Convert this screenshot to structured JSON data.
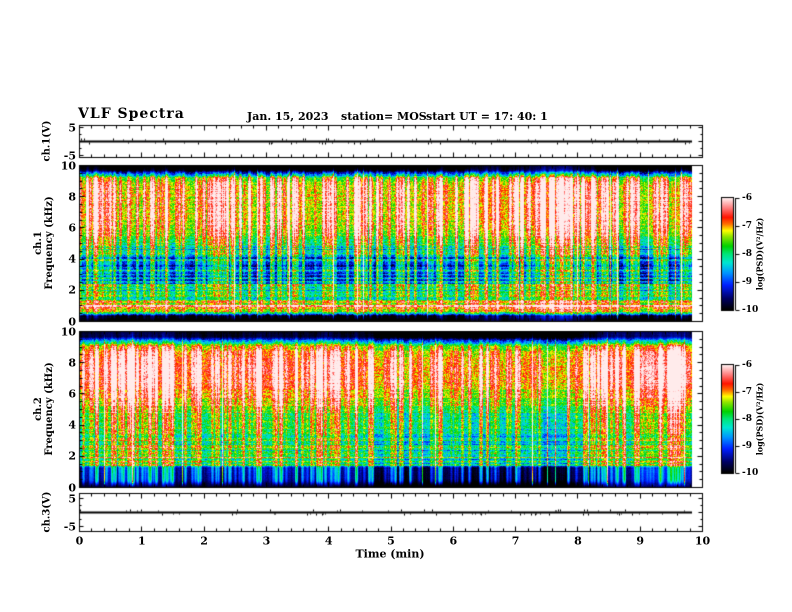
{
  "header": {
    "title": "VLF Spectra",
    "date": "Jan. 15, 2023",
    "station": "station= MOS",
    "start_ut": "start UT =  17: 40: 1"
  },
  "colors": {
    "background": "#ffffff",
    "frame": "#000000",
    "colormap": [
      [
        0.0,
        "#000000"
      ],
      [
        0.1,
        "#000064"
      ],
      [
        0.22,
        "#001eff"
      ],
      [
        0.33,
        "#0096ff"
      ],
      [
        0.42,
        "#00e6d2"
      ],
      [
        0.5,
        "#00e678"
      ],
      [
        0.57,
        "#00d200"
      ],
      [
        0.66,
        "#96e600"
      ],
      [
        0.71,
        "#ffff00"
      ],
      [
        0.77,
        "#ff6e00"
      ],
      [
        0.83,
        "#ff1400"
      ],
      [
        0.91,
        "#ff7878"
      ],
      [
        1.0,
        "#ffebeb"
      ]
    ]
  },
  "axes": {
    "time": {
      "label": "Time (min)",
      "min": 0,
      "max": 10,
      "ticks": [
        0,
        1,
        2,
        3,
        4,
        5,
        6,
        7,
        8,
        9,
        10
      ],
      "minor_step": 0.2
    },
    "ch1v": {
      "label": "ch.1(V)",
      "ticks": [
        5,
        -5
      ],
      "range": [
        -5,
        5
      ]
    },
    "spec1": {
      "label_line1": "ch.1",
      "label_line2": "Frequency (kHz)",
      "ticks": [
        10,
        8,
        6,
        4,
        2,
        0
      ],
      "range": [
        0,
        10
      ]
    },
    "spec2": {
      "label_line1": "ch.2",
      "label_line2": "Frequency (kHz)",
      "ticks": [
        10,
        8,
        6,
        4,
        2,
        0
      ],
      "range": [
        0,
        10
      ]
    },
    "ch3v": {
      "label": "ch.3(V)",
      "ticks": [
        5,
        -5
      ],
      "range": [
        -5,
        5
      ]
    }
  },
  "colorbars": [
    {
      "label": "log(PSD)(V²/Hz)",
      "ticks": [
        -6,
        -7,
        -8,
        -9,
        -10
      ],
      "min": -10,
      "max": -6
    },
    {
      "label": "log(PSD)(V²/Hz)",
      "ticks": [
        -6,
        -7,
        -8,
        -9,
        -10
      ],
      "min": -10,
      "max": -6
    }
  ],
  "chart_data": [
    {
      "type": "line",
      "panel": "ch1-voltage",
      "ylabel": "ch.1(V)",
      "ylim": [
        -5,
        5
      ],
      "xlim": [
        0,
        10
      ],
      "x_extent_min": [
        0,
        9.83
      ],
      "baseline_v": 0,
      "description": "flat trace at 0 V with sparse impulsive spikes under 1 V",
      "render": {
        "seed": 911,
        "blip_rate": 0.12
      }
    },
    {
      "type": "heatmap",
      "panel": "ch1-spectrogram",
      "xlabel": "Time (min)",
      "ylabel": "Frequency (kHz)",
      "zlabel": "log(PSD)(V²/Hz)",
      "xlim": [
        0,
        10
      ],
      "ylim": [
        0,
        10
      ],
      "zlim": [
        -10,
        -6
      ],
      "x_extent_min": [
        0,
        9.83
      ],
      "description": "dense vertical sferic streaks; strong red/yellow band 5-9.5 kHz; blue background 2.5-5 kHz with thin horizontal striations; bright cyan/green horizontal lines 1-2.5 kHz; red-orange wavy band 0.5-1.2 kHz; black below 0.4 kHz and above 9.6 kHz",
      "render": {
        "seed": 1337,
        "streak_density": 0.32,
        "bright_lines": 14,
        "profile": [
          [
            0,
            -10
          ],
          [
            0.3,
            -10
          ],
          [
            0.45,
            -8.6
          ],
          [
            0.6,
            -7.5
          ],
          [
            0.9,
            -7.15
          ],
          [
            1.2,
            -7.9
          ],
          [
            1.5,
            -8.8
          ],
          [
            1.9,
            -8.5
          ],
          [
            2.3,
            -8.8
          ],
          [
            2.8,
            -9.2
          ],
          [
            3.8,
            -9.3
          ],
          [
            4.6,
            -8.7
          ],
          [
            5.3,
            -7.9
          ],
          [
            6.2,
            -7.5
          ],
          [
            7.2,
            -7.35
          ],
          [
            8.6,
            -7.3
          ],
          [
            9.2,
            -7.7
          ],
          [
            9.5,
            -9.0
          ],
          [
            9.75,
            -10
          ],
          [
            10,
            -10
          ]
        ],
        "h_lines": [
          [
            0.95,
            0.9
          ],
          [
            1.25,
            1.0
          ],
          [
            1.55,
            1.2
          ],
          [
            1.8,
            1.0
          ],
          [
            2.05,
            1.1
          ],
          [
            2.3,
            0.9
          ],
          [
            2.75,
            0.6
          ],
          [
            3.3,
            0.55
          ],
          [
            3.85,
            0.5
          ],
          [
            4.4,
            0.45
          ],
          [
            4.9,
            0.4
          ]
        ],
        "row_noise_gain": [
          [
            0,
            0.05
          ],
          [
            0.45,
            0.25
          ],
          [
            1.3,
            0.55
          ],
          [
            1.5,
            0.75
          ],
          [
            2.6,
            0.8
          ],
          [
            4.9,
            0.65
          ],
          [
            5.5,
            0.3
          ],
          [
            9.3,
            0.25
          ],
          [
            10,
            0.05
          ]
        ],
        "streak_gain": [
          [
            0,
            0.05
          ],
          [
            0.4,
            0.45
          ],
          [
            1.3,
            0.6
          ],
          [
            2.4,
            0.85
          ],
          [
            4.8,
            1.05
          ],
          [
            9.2,
            1.0
          ],
          [
            9.55,
            0.5
          ],
          [
            9.8,
            0.15
          ],
          [
            10,
            0.05
          ]
        ]
      }
    },
    {
      "type": "heatmap",
      "panel": "ch2-spectrogram",
      "xlabel": "Time (min)",
      "ylabel": "Frequency (kHz)",
      "zlabel": "log(PSD)(V²/Hz)",
      "xlim": [
        0,
        10
      ],
      "ylim": [
        0,
        10
      ],
      "zlim": [
        -10,
        -6
      ],
      "x_extent_min": [
        0,
        9.83
      ],
      "description": "diffuse strong red/orange band 5.5-9 kHz with yellow-green edges; cyan/blue streaky region 2-5.5 kHz; dark band 1.3-2 kHz crossed by bright cyan/green horizontal lines; mostly black 0.3-1.3 kHz with sparse colored streaks; black top edge above 9.5 kHz",
      "render": {
        "seed": 4242,
        "streak_density": 0.27,
        "bright_lines": 12,
        "profile": [
          [
            0,
            -10
          ],
          [
            0.3,
            -10
          ],
          [
            0.45,
            -9.85
          ],
          [
            1.2,
            -9.8
          ],
          [
            1.4,
            -9.4
          ],
          [
            1.6,
            -9.15
          ],
          [
            1.95,
            -8.9
          ],
          [
            2.5,
            -8.55
          ],
          [
            3.3,
            -8.6
          ],
          [
            4.2,
            -8.5
          ],
          [
            5.0,
            -8.1
          ],
          [
            5.8,
            -7.6
          ],
          [
            6.6,
            -7.2
          ],
          [
            7.6,
            -7.0
          ],
          [
            8.6,
            -7.2
          ],
          [
            9.1,
            -7.8
          ],
          [
            9.45,
            -9.1
          ],
          [
            9.7,
            -10
          ],
          [
            10,
            -10
          ]
        ],
        "h_lines": [
          [
            1.4,
            1.5
          ],
          [
            1.62,
            1.35
          ],
          [
            1.88,
            1.45
          ],
          [
            2.12,
            0.9
          ],
          [
            2.5,
            0.55
          ],
          [
            3.0,
            0.4
          ]
        ],
        "row_noise_gain": [
          [
            0,
            0.02
          ],
          [
            1.2,
            0.1
          ],
          [
            1.9,
            0.4
          ],
          [
            2.4,
            0.55
          ],
          [
            5,
            0.5
          ],
          [
            6,
            0.3
          ],
          [
            9.2,
            0.25
          ],
          [
            10,
            0.03
          ]
        ],
        "streak_gain": [
          [
            0,
            0.05
          ],
          [
            0.35,
            0.75
          ],
          [
            1.25,
            0.8
          ],
          [
            2,
            0.75
          ],
          [
            3,
            0.85
          ],
          [
            5,
            0.95
          ],
          [
            8.8,
            0.85
          ],
          [
            9.4,
            0.4
          ],
          [
            9.7,
            0.12
          ],
          [
            10,
            0.04
          ]
        ]
      }
    },
    {
      "type": "line",
      "panel": "ch3-voltage",
      "ylabel": "ch.3(V)",
      "ylim": [
        -5,
        5
      ],
      "xlim": [
        0,
        10
      ],
      "x_extent_min": [
        0,
        9.83
      ],
      "baseline_v": 0,
      "description": "flat trace at 0 V with sparse impulsive spikes under 1 V",
      "render": {
        "seed": 313,
        "blip_rate": 0.14
      }
    }
  ]
}
